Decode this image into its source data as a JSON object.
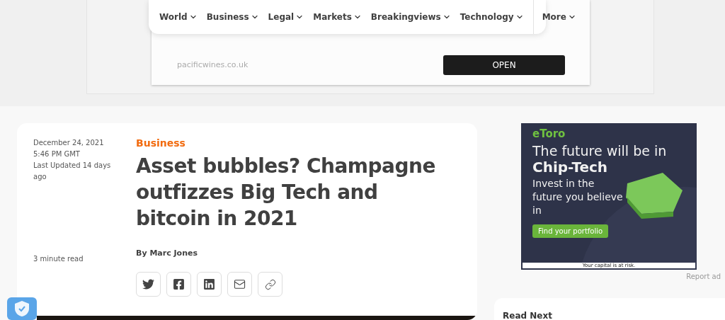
{
  "nav": {
    "items": [
      {
        "label": "World"
      },
      {
        "label": "Business"
      },
      {
        "label": "Legal"
      },
      {
        "label": "Markets"
      },
      {
        "label": "Breakingviews"
      },
      {
        "label": "Technology"
      }
    ],
    "more": "More"
  },
  "top_ad": {
    "domain": "pacificwines.co.uk",
    "button": "OPEN"
  },
  "article": {
    "date": "December 24, 2021",
    "time": "5:46 PM GMT",
    "updated": "Last Updated 14 days ago",
    "read_time": "3 minute read",
    "section": "Business",
    "headline": "Asset bubbles? Champagne outfizzes Big Tech and bitcoin in 2021",
    "byline": "By Marc Jones",
    "share": [
      {
        "kind": "twitter"
      },
      {
        "kind": "facebook"
      },
      {
        "kind": "linkedin"
      },
      {
        "kind": "email"
      },
      {
        "kind": "link"
      }
    ]
  },
  "side_ad": {
    "brand": "eToro",
    "line1": "The future will be in",
    "line2": "Chip-Tech",
    "line3": "Invest in the future you believe in",
    "cta": "Find your portfolio",
    "disclaimer": "Your capital is at risk.",
    "report": "Report ad"
  },
  "read_next": {
    "title": "Read Next"
  }
}
